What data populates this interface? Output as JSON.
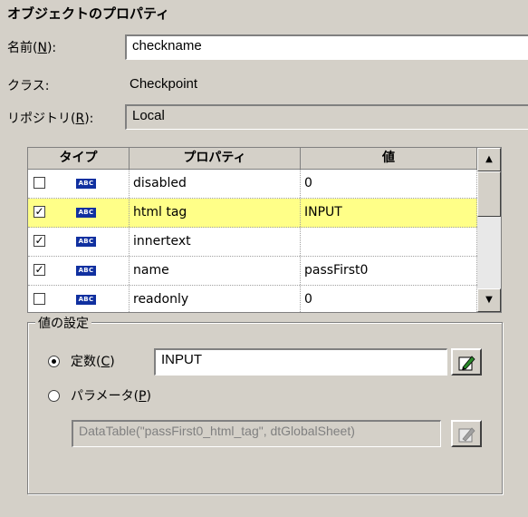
{
  "title": "オブジェクトのプロパティ",
  "name_label": "名前(",
  "name_label_key": "N",
  "name_label_end": "):",
  "name_value": "checkname",
  "class_label": "クラス:",
  "class_value": "Checkpoint",
  "repo_label": "リポジトリ(",
  "repo_label_key": "R",
  "repo_label_end": "):",
  "repo_value": "Local",
  "grid": {
    "headers": [
      "タイプ",
      "プロパティ",
      "値"
    ],
    "badge": "ABC",
    "rows": [
      {
        "checked": false,
        "property": "disabled",
        "value": "0",
        "selected": false
      },
      {
        "checked": true,
        "property": "html tag",
        "value": "INPUT",
        "selected": true
      },
      {
        "checked": true,
        "property": "innertext",
        "value": "",
        "selected": false
      },
      {
        "checked": true,
        "property": "name",
        "value": "passFirst0",
        "selected": false
      },
      {
        "checked": false,
        "property": "readonly",
        "value": "0",
        "selected": false
      }
    ]
  },
  "value_settings": {
    "legend": "値の設定",
    "constant_label": "定数(",
    "constant_key": "C",
    "constant_end": ")",
    "constant_value": "INPUT",
    "parameter_label": "パラメータ(",
    "parameter_key": "P",
    "parameter_end": ")",
    "parameter_value": "DataTable(\"passFirst0_html_tag\", dtGlobalSheet)",
    "selected": "constant"
  },
  "colors": {
    "selected_row": "#ffff88",
    "badge": "#1030a0",
    "window": "#d4d0c8"
  }
}
